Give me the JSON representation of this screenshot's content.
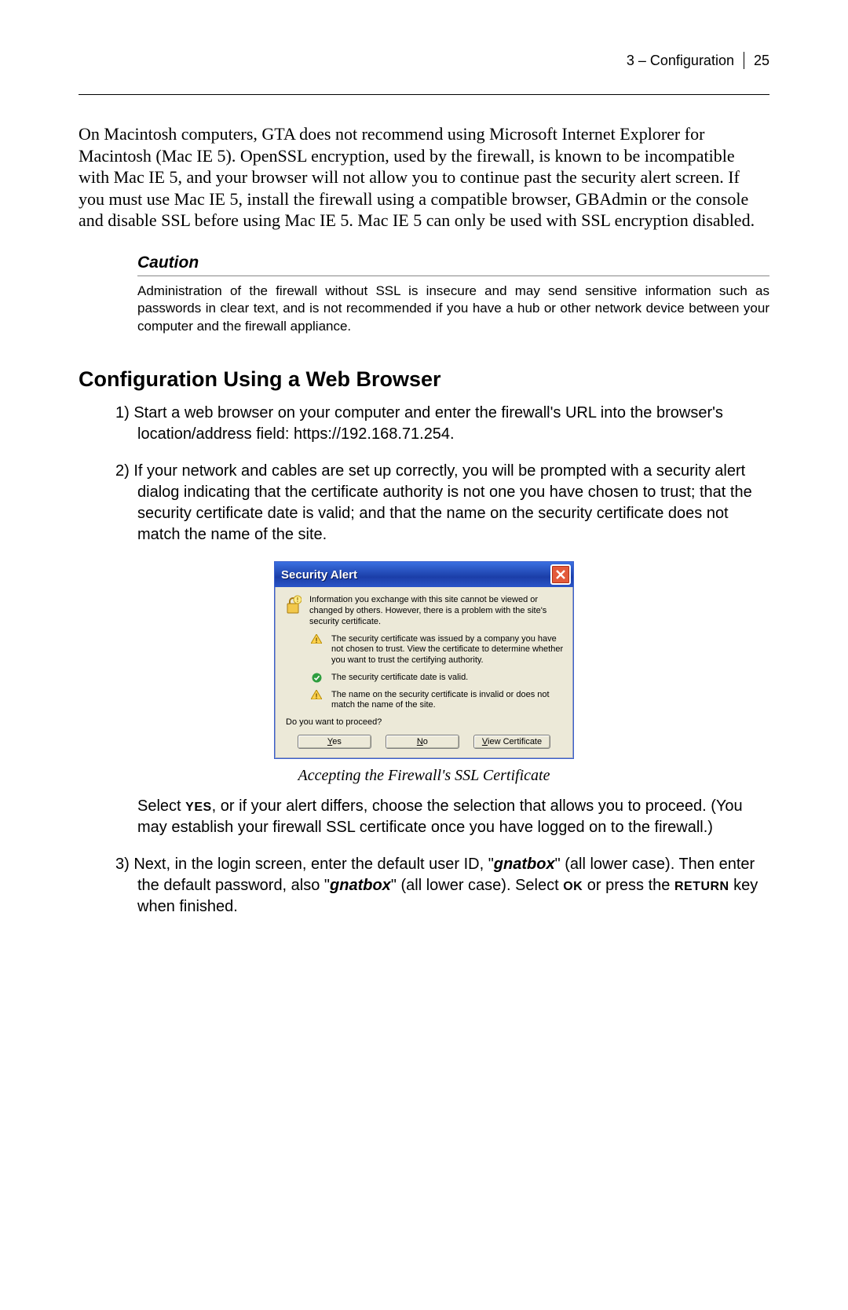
{
  "header": {
    "chapter": "3 – Configuration",
    "page": "25"
  },
  "para_intro": "On Macintosh computers, GTA does not recommend using Microsoft Internet Explorer for Macintosh (Mac IE 5). OpenSSL encryption, used by the firewall, is known to be incompatible with Mac IE 5, and your browser will not allow you to continue past the security alert screen. If you must use Mac IE 5, install the firewall using a compatible browser, GBAdmin or the console and disable SSL before using Mac IE 5. Mac IE 5 can only be used with SSL encryption disabled.",
  "caution": {
    "label": "Caution",
    "body": "Administration of the firewall without SSL is insecure and may send sensitive information such as passwords in clear text, and is not recommended if you have a hub or other network device between your computer and the firewall appliance."
  },
  "section_title": "Configuration Using a Web Browser",
  "steps": {
    "s1": "1) Start a web browser on your computer and enter the firewall's URL into the browser's location/address field: https://192.168.71.254.",
    "s2": "2) If your network and cables are set up correctly, you will be prompted with a security alert dialog indicating that the certificate authority is not one you have chosen to trust; that the security certificate date is valid; and that the name on the security certificate does not match the name of the site.",
    "s2b_pre": "Select ",
    "s2b_yes": "YES",
    "s2b_post": ", or if your alert differs, choose the selection that allows you to proceed. (You may establish your firewall SSL certificate once you have logged on to the firewall.)",
    "s3_a": "3) Next, in the login screen, enter the default user ID, \"",
    "s3_gnat1": "gnatbox",
    "s3_b": "\" (all lower case). Then enter the default password, also \"",
    "s3_gnat2": "gnatbox",
    "s3_c": "\" (all lower case). Select ",
    "s3_ok": "OK",
    "s3_d": " or press the ",
    "s3_ret": "RETURN",
    "s3_e": " key when finished."
  },
  "figure_caption": "Accepting the Firewall's SSL Certificate",
  "dialog": {
    "title": "Security Alert",
    "intro": "Information you exchange with this site cannot be viewed or changed by others. However, there is a problem with the site's security certificate.",
    "item1": "The security certificate was issued by a company you have not chosen to trust. View the certificate to determine whether you want to trust the certifying authority.",
    "item2": "The security certificate date is valid.",
    "item3": "The name on the security certificate is invalid or does not match the name of the site.",
    "proceed": "Do you want to proceed?",
    "buttons": {
      "yes_u": "Y",
      "yes_rest": "es",
      "no_u": "N",
      "no_rest": "o",
      "view_u": "V",
      "view_rest": "iew Certificate"
    }
  }
}
